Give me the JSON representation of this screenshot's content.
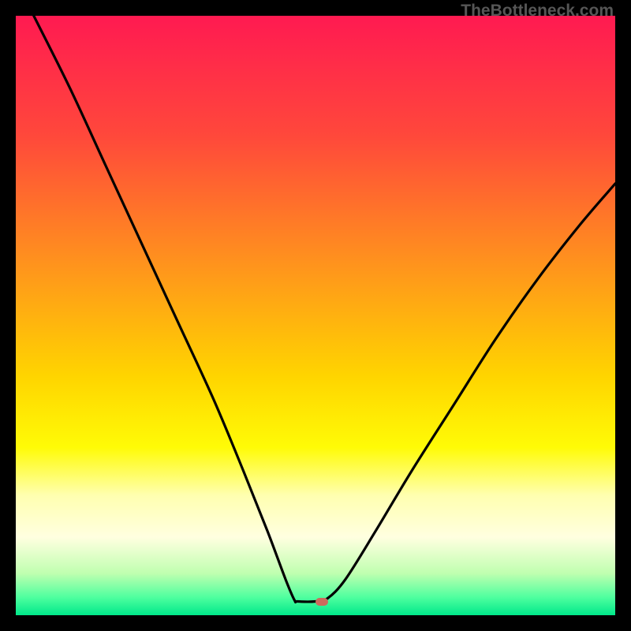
{
  "watermark": "TheBottleneck.com",
  "chart_data": {
    "type": "line",
    "title": "",
    "xlabel": "",
    "ylabel": "",
    "xlim": [
      0,
      100
    ],
    "ylim": [
      0,
      100
    ],
    "gradient_stops": [
      {
        "offset": 0,
        "color": "#ff1a51"
      },
      {
        "offset": 20,
        "color": "#ff483b"
      },
      {
        "offset": 40,
        "color": "#ff8e1f"
      },
      {
        "offset": 60,
        "color": "#ffd400"
      },
      {
        "offset": 72,
        "color": "#fffb06"
      },
      {
        "offset": 80,
        "color": "#ffffb0"
      },
      {
        "offset": 87,
        "color": "#ffffe0"
      },
      {
        "offset": 93,
        "color": "#c0ffb0"
      },
      {
        "offset": 97,
        "color": "#4fff9f"
      },
      {
        "offset": 100,
        "color": "#00e88a"
      }
    ],
    "series": [
      {
        "name": "bottleneck-curve",
        "points": [
          {
            "x": 3,
            "y": 100
          },
          {
            "x": 9,
            "y": 88
          },
          {
            "x": 15,
            "y": 75
          },
          {
            "x": 21,
            "y": 62
          },
          {
            "x": 27,
            "y": 49
          },
          {
            "x": 33,
            "y": 36
          },
          {
            "x": 38,
            "y": 24
          },
          {
            "x": 42,
            "y": 14
          },
          {
            "x": 45,
            "y": 6
          },
          {
            "x": 46.5,
            "y": 2.5
          },
          {
            "x": 47,
            "y": 2.3
          },
          {
            "x": 50,
            "y": 2.3
          },
          {
            "x": 52,
            "y": 2.8
          },
          {
            "x": 55,
            "y": 6
          },
          {
            "x": 60,
            "y": 14
          },
          {
            "x": 66,
            "y": 24
          },
          {
            "x": 73,
            "y": 35
          },
          {
            "x": 80,
            "y": 46
          },
          {
            "x": 87,
            "y": 56
          },
          {
            "x": 94,
            "y": 65
          },
          {
            "x": 100,
            "y": 72
          }
        ]
      }
    ],
    "marker": {
      "x": 51,
      "y": 2.3,
      "color": "#cc6a5d"
    }
  }
}
